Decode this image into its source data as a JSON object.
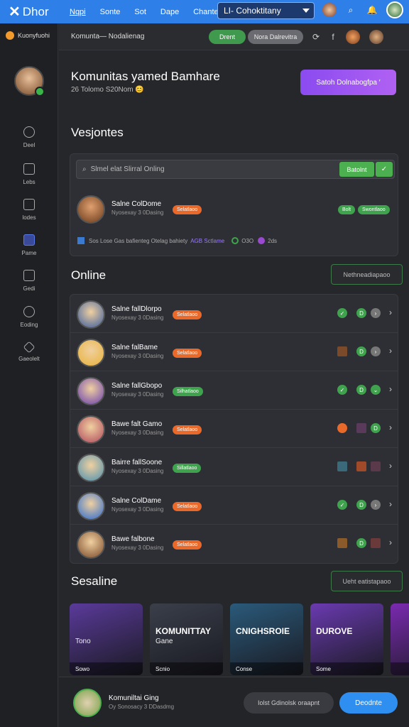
{
  "topbar": {
    "logo": "Dhor",
    "nav": [
      "Nqpi",
      "Sonte",
      "Sot",
      "Dape",
      "Chante"
    ],
    "select": "LI- Cohoktitany"
  },
  "sidebar": {
    "header": "Kuonyfuohi",
    "items": [
      {
        "label": "Deel",
        "icon": "clock-icon"
      },
      {
        "label": "Lebs",
        "icon": "document-icon"
      },
      {
        "label": "lodes",
        "icon": "gallery-icon"
      },
      {
        "label": "Pame",
        "icon": "chat-icon"
      },
      {
        "label": "Gedi",
        "icon": "gamepad-icon"
      },
      {
        "label": "Eoding",
        "icon": "settings-icon"
      },
      {
        "label": "Gaeolelt",
        "icon": "diamond-icon"
      }
    ]
  },
  "main": {
    "breadcrumb": "Komunta— Nodalienag",
    "pill_green": "Drent",
    "pill_gray": "Nora Dalrevitra",
    "hero_title": "Komunitas yamed Bamhare",
    "hero_sub": "26 Tolomo S20Nom 😊",
    "hero_button": "Satoh Dolnabogfpa  ′",
    "section1": "Vesjontes",
    "search_placeholder": "Slmel elat Slirral Onling",
    "search_button": "Batolnt",
    "search_button_icon": "✓",
    "featured": {
      "name": "Salne ColDome",
      "sub": "Nyosexay 3 0Dasing",
      "tag": "Selatlaoo",
      "tag2": "Bolt",
      "tag3": "Swontlaoo",
      "note": "Sos Lose Gas bafienteg Otelag bahiety",
      "note_link": "AGB Sctlame",
      "note_stats": "O3O",
      "note_extra": "2ds"
    },
    "section2": "Online",
    "section2_button": "Nethneadiapaoo",
    "online": [
      {
        "name": "Salne fallDlorpo",
        "sub": "Nyosexay 3 0Dasing",
        "tag": "Selatlaoo",
        "tag_color": "#e8692a",
        "art": "#3a5d9f"
      },
      {
        "name": "Salne falBame",
        "sub": "Nyosexay 3 0Dasing",
        "tag": "Selatlaoo",
        "tag_color": "#e8692a",
        "art": "#e8b23a"
      },
      {
        "name": "Salne fallGbopo",
        "sub": "Nyosexay 3 0Dasing",
        "tag": "Silhatlaoo",
        "tag_color": "#3fa34d",
        "art": "#6a3fb0"
      },
      {
        "name": "Bawe falt Gamo",
        "sub": "Nyosexay 3 0Dasing",
        "tag": "Selatlaoo",
        "tag_color": "#e8692a",
        "art": "#b0485c"
      },
      {
        "name": "Bairre fallSoone",
        "sub": "Nyosexay 3 0Dasing",
        "tag": "Sillatlaoo",
        "tag_color": "#3fa34d",
        "art": "#4a8fb0"
      },
      {
        "name": "Salne ColDame",
        "sub": "Nyosexay 3 0Dasing",
        "tag": "Selatlaoo",
        "tag_color": "#e8692a",
        "art": "#2a6ad0"
      },
      {
        "name": "Bawe falbone",
        "sub": "Nyosexay 3 0Dasing",
        "tag": "Selatlaoo",
        "tag_color": "#e8692a",
        "art": "#7a4a2a"
      }
    ],
    "section3": "Sesaline",
    "section3_button": "Ueht eatistapaoo",
    "cards": [
      {
        "title": "",
        "sub": "Tono",
        "foot": "Sowo",
        "color": "#5a3a9a"
      },
      {
        "title": "KOMUNITTAY",
        "sub": "Gane",
        "foot": "Scnio",
        "color": "#3a3f4a"
      },
      {
        "title": "CNIGHSROIE",
        "sub": "",
        "foot": "Conse",
        "color": "#2a5a7a"
      },
      {
        "title": "DUROVE",
        "sub": "",
        "foot": "Some",
        "color": "#6a3ab0"
      },
      {
        "title": "",
        "sub": "",
        "foot": "",
        "color": "#7a2ab0"
      }
    ]
  },
  "bottom": {
    "name": "Komuniltai Ging",
    "sub": "Oy Sonosacy 3 DDasdmg",
    "btn1": "Iolst Gdinolsk oraapnt",
    "btn2": "Deodnte"
  }
}
